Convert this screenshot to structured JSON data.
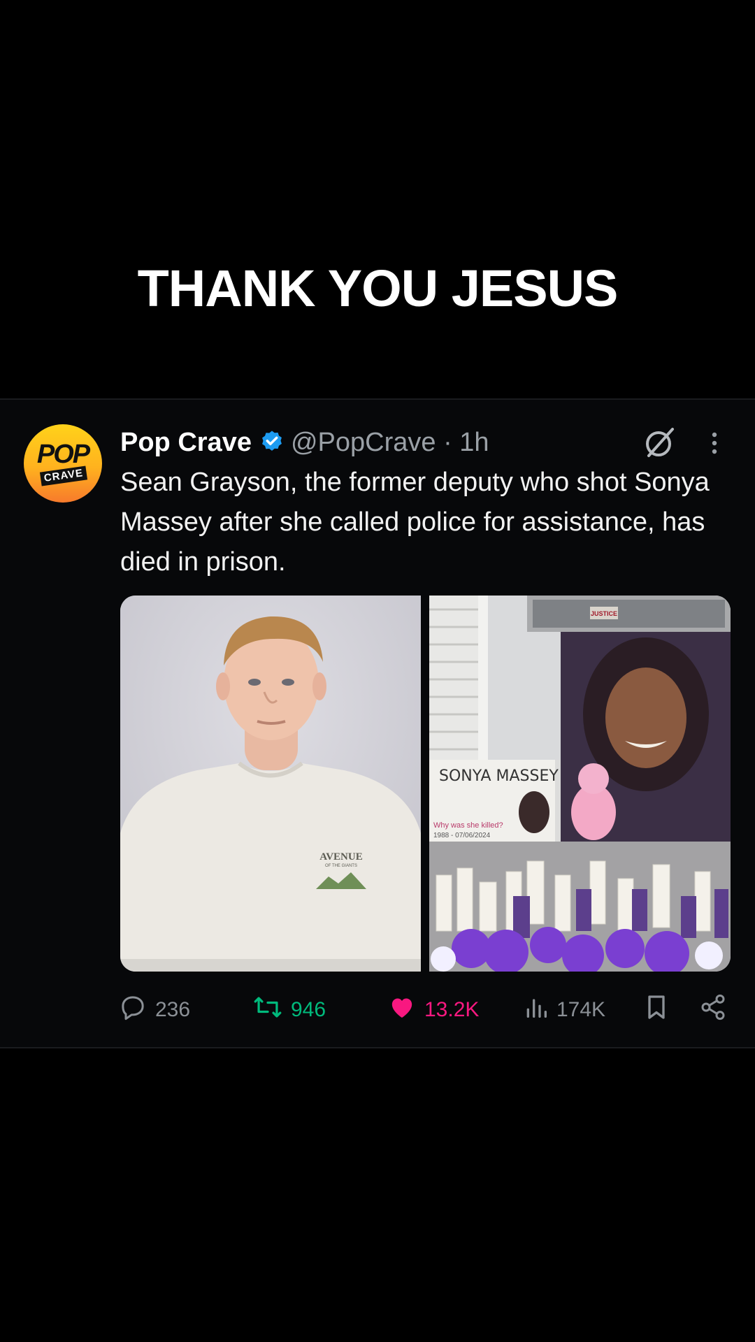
{
  "overlay_caption": "THANK YOU JESUS",
  "tweet": {
    "avatar": {
      "top": "POP",
      "bottom": "CRAVE"
    },
    "author_name": "Pop Crave",
    "handle_time": "@PopCrave · 1h",
    "text": "Sean Grayson, the former deputy who shot Sonya Massey after she called police for assistance, has died in prison.",
    "images": [
      {
        "shirt_text_top": "AVENUE",
        "shirt_text_bottom": "OF THE GIANTS"
      },
      {
        "sign_name": "SONYA MASSEY",
        "sign_question": "Why was she killed?",
        "sign_dates": "1988 - 07/06/2024",
        "flyer_text": "JUSTICE"
      }
    ],
    "stats": {
      "replies": "236",
      "retweets": "946",
      "likes": "13.2K",
      "views": "174K"
    }
  },
  "colors": {
    "background": "#000000",
    "text": "#e7e9ea",
    "muted": "#8b9096",
    "verified": "#1d9bf0",
    "retweet": "#00ba7c",
    "like": "#f91880"
  }
}
